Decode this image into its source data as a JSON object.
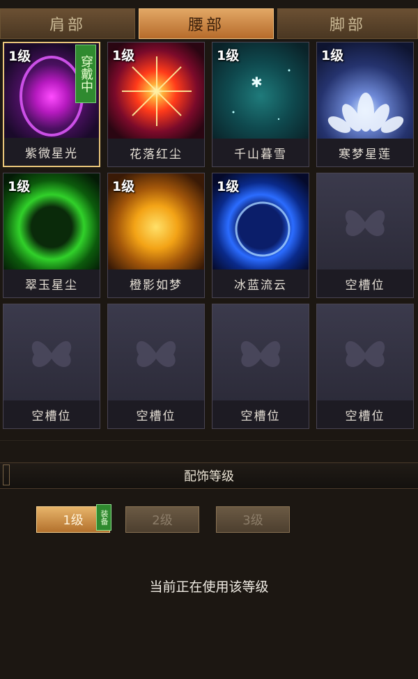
{
  "tabs": [
    {
      "label": "肩部",
      "active": false
    },
    {
      "label": "腰部",
      "active": true
    },
    {
      "label": "脚部",
      "active": false
    }
  ],
  "slots": [
    {
      "name": "紫微星光",
      "level": "1级",
      "badge": "穿戴中",
      "icon": "purple-orb-icon",
      "color": "#c21ac8",
      "selected": true
    },
    {
      "name": "花落红尘",
      "level": "1级",
      "icon": "red-star-burst-icon",
      "color": "#ff7a1a"
    },
    {
      "name": "千山暮雪",
      "level": "1级",
      "icon": "snowflake-sparkle-icon",
      "color": "#1b6e6e"
    },
    {
      "name": "寒梦星莲",
      "level": "1级",
      "icon": "lotus-icon",
      "color": "#2b3a7a"
    },
    {
      "name": "翠玉星尘",
      "level": "1级",
      "icon": "green-ring-icon",
      "color": "#31d12a"
    },
    {
      "name": "橙影如梦",
      "level": "1级",
      "icon": "orange-sun-icon",
      "color": "#f3a316"
    },
    {
      "name": "冰蓝流云",
      "level": "1级",
      "icon": "blue-swirl-icon",
      "color": "#2b6cff"
    },
    {
      "name": "空槽位",
      "empty": true,
      "icon": "butterfly-icon"
    },
    {
      "name": "空槽位",
      "empty": true,
      "icon": "butterfly-icon"
    },
    {
      "name": "空槽位",
      "empty": true,
      "icon": "butterfly-icon"
    },
    {
      "name": "空槽位",
      "empty": true,
      "icon": "butterfly-icon"
    },
    {
      "name": "空槽位",
      "empty": true,
      "icon": "butterfly-icon"
    }
  ],
  "level_section": {
    "title": "配饰等级",
    "buttons": [
      {
        "label": "1级",
        "active": true,
        "tag": "装备"
      },
      {
        "label": "2级",
        "active": false
      },
      {
        "label": "3级",
        "active": false
      }
    ],
    "status_text": "当前正在使用该等级"
  }
}
